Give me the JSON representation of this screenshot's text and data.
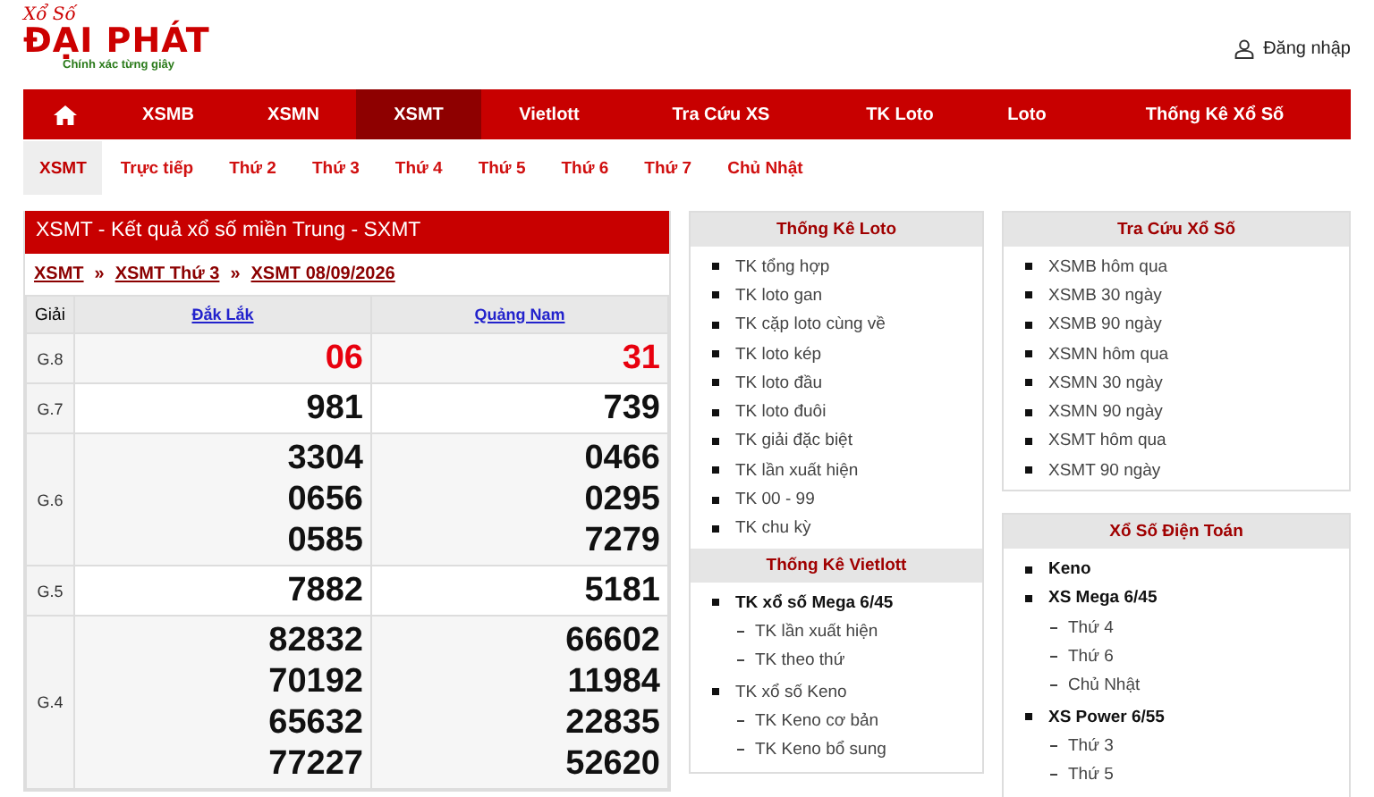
{
  "logo": {
    "script_text": "Xổ Số",
    "brand": "ĐẠI PHÁT",
    "slogan": "Chính xác từng giây"
  },
  "login": {
    "label": "Đăng nhập"
  },
  "nav": [
    {
      "kind": "home",
      "selected": false
    },
    {
      "kind": "text",
      "label": "XSMB",
      "selected": false
    },
    {
      "kind": "text",
      "label": "XSMN",
      "selected": false
    },
    {
      "kind": "text",
      "label": "XSMT",
      "selected": true
    },
    {
      "kind": "text",
      "label": "Vietlott",
      "selected": false
    },
    {
      "kind": "text",
      "label": "Tra Cứu XS",
      "selected": false
    },
    {
      "kind": "text",
      "label": "TK Loto",
      "selected": false
    },
    {
      "kind": "text",
      "label": "Loto",
      "selected": false
    },
    {
      "kind": "text",
      "label": "Thống Kê Xổ Số",
      "selected": false
    }
  ],
  "subnav": [
    {
      "label": "XSMT",
      "selected": true
    },
    {
      "label": "Trực tiếp",
      "selected": false
    },
    {
      "label": "Thứ 2",
      "selected": false
    },
    {
      "label": "Thứ 3",
      "selected": false
    },
    {
      "label": "Thứ 4",
      "selected": false
    },
    {
      "label": "Thứ 5",
      "selected": false
    },
    {
      "label": "Thứ 6",
      "selected": false
    },
    {
      "label": "Thứ 7",
      "selected": false
    },
    {
      "label": "Chủ Nhật",
      "selected": false
    }
  ],
  "results": {
    "title": "XSMT - Kết quả xổ số miền Trung - SXMT",
    "breadcrumb": [
      "XSMT",
      "»",
      "XSMT Thứ 3",
      "»",
      "XSMT 08/09/2026"
    ],
    "columns": [
      "Giải",
      "Đắk Lắk",
      "Quảng Nam"
    ],
    "rows": [
      {
        "prize": "G.8",
        "highlight": true,
        "values": [
          [
            "06"
          ],
          [
            "31"
          ]
        ]
      },
      {
        "prize": "G.7",
        "highlight": false,
        "values": [
          [
            "981"
          ],
          [
            "739"
          ]
        ]
      },
      {
        "prize": "G.6",
        "highlight": false,
        "values": [
          [
            "3304",
            "0656",
            "0585"
          ],
          [
            "0466",
            "0295",
            "7279"
          ]
        ]
      },
      {
        "prize": "G.5",
        "highlight": false,
        "values": [
          [
            "7882"
          ],
          [
            "5181"
          ]
        ]
      },
      {
        "prize": "G.4",
        "highlight": false,
        "values": [
          [
            "82832",
            "70192",
            "65632",
            "77227"
          ],
          [
            "66602",
            "11984",
            "22835",
            "52620"
          ]
        ]
      }
    ]
  },
  "side_columns": [
    {
      "kind": "stacked",
      "panels": [
        {
          "title": "Thống Kê Loto",
          "items": [
            {
              "label": "TK tổng hợp",
              "bold": false
            },
            {
              "label": "TK loto gan",
              "bold": false
            },
            {
              "label": "TK cặp loto cùng về",
              "bold": false
            },
            {
              "label": "TK loto kép",
              "bold": false
            },
            {
              "label": "TK loto đầu",
              "bold": false
            },
            {
              "label": "TK loto đuôi",
              "bold": false
            },
            {
              "label": "TK giải đặc biệt",
              "bold": false
            },
            {
              "label": "TK lần xuất hiện",
              "bold": false
            },
            {
              "label": "TK 00 - 99",
              "bold": false
            },
            {
              "label": "TK chu kỳ",
              "bold": false
            }
          ]
        },
        {
          "title": "Thống Kê Vietlott",
          "items": [
            {
              "label": "TK xổ số Mega 6/45",
              "bold": true,
              "children": [
                "TK lần xuất hiện",
                "TK theo thứ"
              ]
            },
            {
              "label": "TK xổ số Keno",
              "bold": false,
              "children": [
                "TK Keno cơ bản",
                "TK Keno bổ sung"
              ]
            }
          ]
        }
      ]
    },
    {
      "kind": "separate",
      "panels": [
        {
          "title": "Tra Cứu Xổ Số",
          "items": [
            {
              "label": "XSMB hôm qua",
              "bold": false
            },
            {
              "label": "XSMB 30 ngày",
              "bold": false
            },
            {
              "label": "XSMB 90 ngày",
              "bold": false
            },
            {
              "label": "XSMN hôm qua",
              "bold": false
            },
            {
              "label": "XSMN 30 ngày",
              "bold": false
            },
            {
              "label": "XSMN 90 ngày",
              "bold": false
            },
            {
              "label": "XSMT hôm qua",
              "bold": false
            },
            {
              "label": "XSMT 90 ngày",
              "bold": false
            }
          ]
        },
        {
          "title": "Xổ Số Điện Toán",
          "items": [
            {
              "label": "Keno",
              "bold": true
            },
            {
              "label": "XS Mega 6/45",
              "bold": true,
              "children": [
                "Thứ 4",
                "Thứ 6",
                "Chủ Nhật"
              ]
            },
            {
              "label": "XS Power 6/55",
              "bold": true,
              "children": [
                "Thứ 3",
                "Thứ 5"
              ]
            }
          ]
        }
      ]
    }
  ]
}
